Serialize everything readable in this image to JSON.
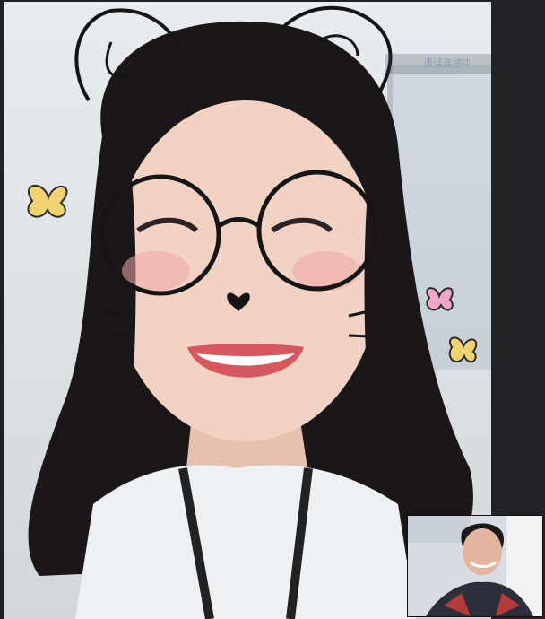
{
  "call": {
    "overlay_caption": "通话连接中",
    "remote_participant": "remote-participant",
    "local_participant": "local-participant"
  },
  "colors": {
    "panel_bg": "#202226",
    "hair": "#1b1718",
    "skin": "#f1d2c3"
  },
  "icons": {
    "filter_cat_ears": "cat-ears-icon",
    "filter_glasses": "round-glasses-icon",
    "filter_nose": "heart-nose-icon",
    "filter_whiskers": "whiskers-icon",
    "butterfly": "butterfly-icon"
  }
}
